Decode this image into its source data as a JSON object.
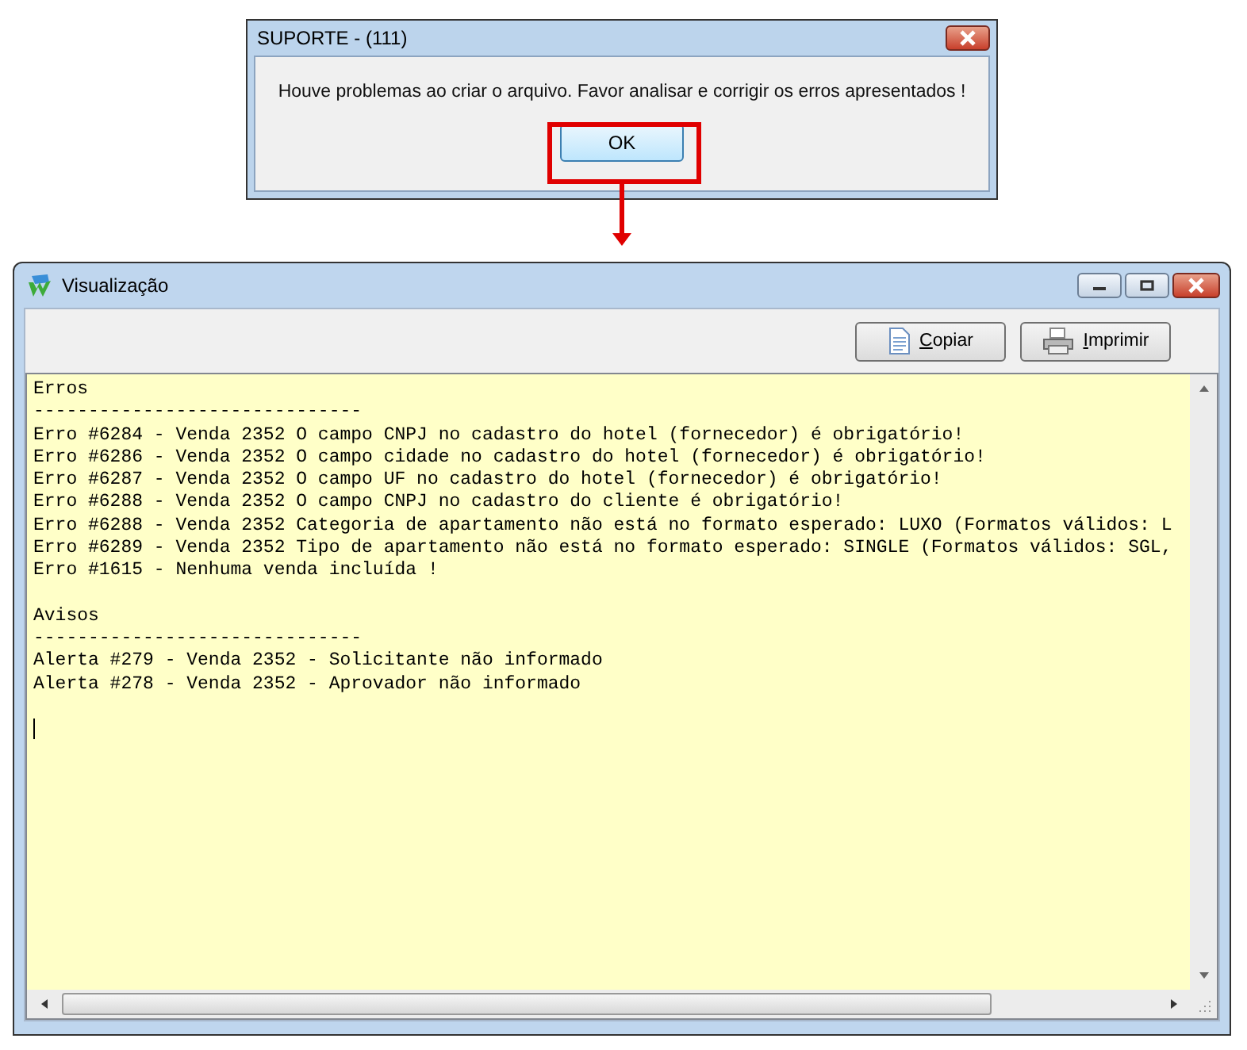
{
  "dialog": {
    "title": "SUPORTE - (111)",
    "message": "Houve problemas ao criar o arquivo. Favor analisar e corrigir os erros apresentados !",
    "buttons": [
      "OK"
    ]
  },
  "window": {
    "title": "Visualização"
  },
  "toolbar": [
    {
      "kind": "copy",
      "label": "Copiar"
    },
    {
      "kind": "print",
      "label": "Imprimir"
    }
  ],
  "report": [
    {
      "heading": "Erros",
      "separator": "------------------------------",
      "lines": [
        "Erro #6284 - Venda 2352 O campo CNPJ no cadastro do hotel (fornecedor) é obrigatório!",
        "Erro #6286 - Venda 2352 O campo cidade no cadastro do hotel (fornecedor) é obrigatório!",
        "Erro #6287 - Venda 2352 O campo UF no cadastro do hotel (fornecedor) é obrigatório!",
        "Erro #6288 - Venda 2352 O campo CNPJ no cadastro do cliente é obrigatório!",
        "Erro #6288 - Venda 2352 Categoria de apartamento não está no formato esperado: LUXO (Formatos válidos: L",
        "Erro #6289 - Venda 2352 Tipo de apartamento não está no formato esperado: SINGLE (Formatos válidos: SGL,",
        "Erro #1615 - Nenhuma venda incluída !"
      ]
    },
    {
      "heading": "Avisos",
      "separator": "------------------------------",
      "lines": [
        "Alerta #279 - Venda 2352 - Solicitante não informado",
        "Alerta #278 - Venda 2352 - Aprovador não informado"
      ]
    }
  ]
}
